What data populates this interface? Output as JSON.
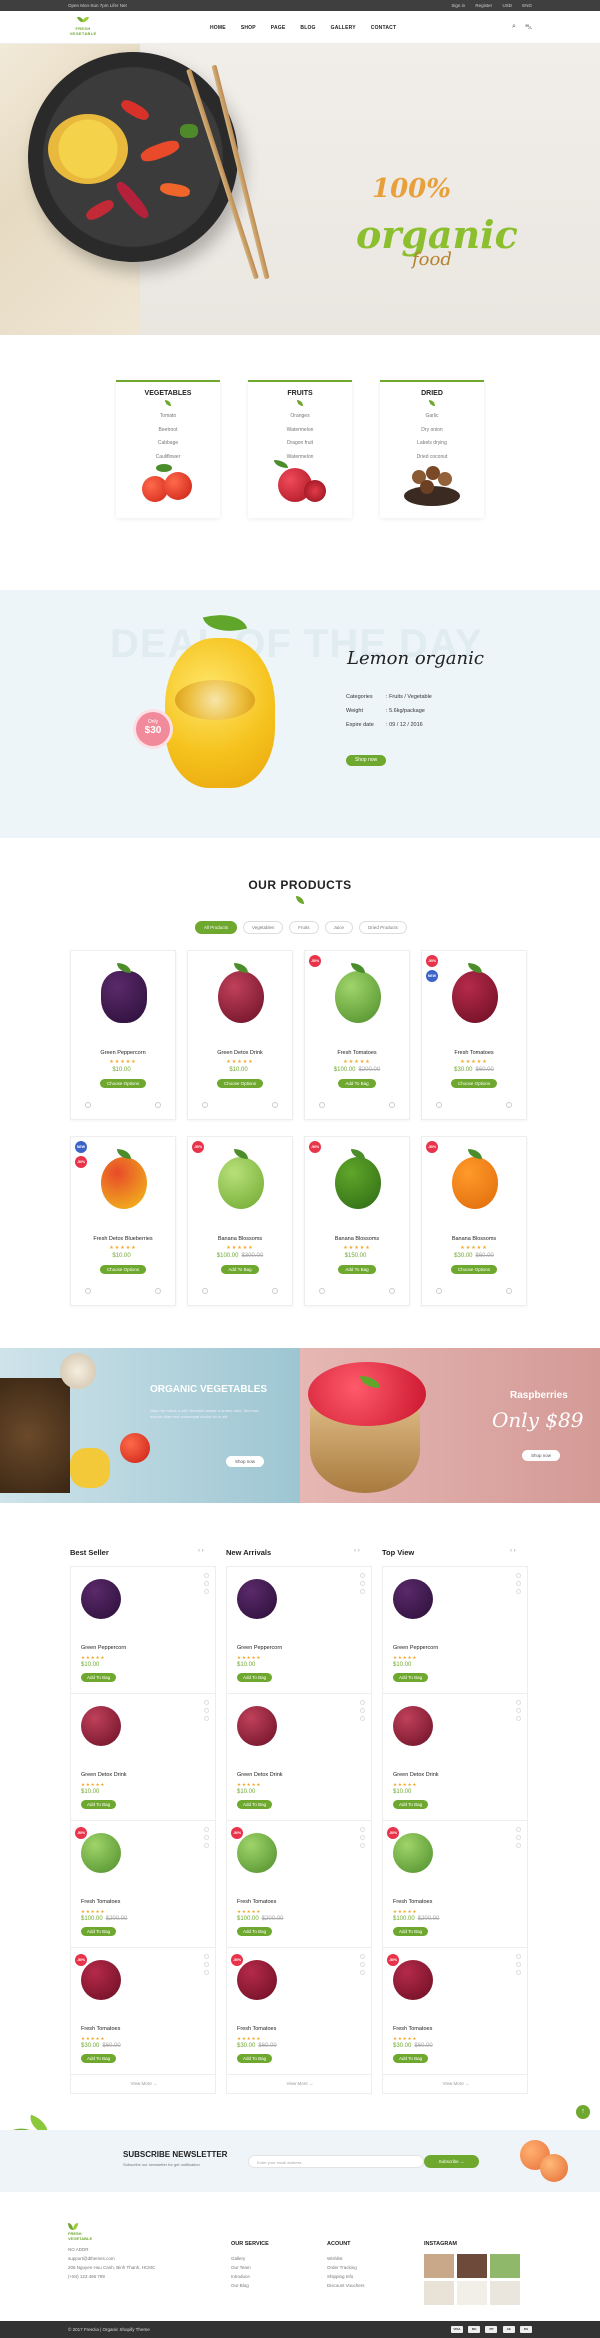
{
  "topbar": {
    "left": "Open Mon-Sun 7pm Lifer Net",
    "links": [
      "Sign in",
      "Register",
      "USD",
      "ENG"
    ]
  },
  "brand": {
    "logo": "FRESH VEGETABLE"
  },
  "nav": [
    "HOME",
    "SHOP",
    "PAGE",
    "BLOG",
    "GALLERY",
    "CONTACT"
  ],
  "hero": {
    "line1": "100%",
    "line2": "organic",
    "line3": "food"
  },
  "categories": [
    {
      "title": "VEGETABLES",
      "items": [
        "Tomato",
        "Beetroot",
        "Cabbage",
        "Cauliflower"
      ]
    },
    {
      "title": "FRUITS",
      "items": [
        "Oranges",
        "Watermelon",
        "Dragon fruit",
        "Watermelon"
      ]
    },
    {
      "title": "DRIED",
      "items": [
        "Garlic",
        "Dry onion",
        "Labels drying",
        "Dried coconut"
      ]
    }
  ],
  "deal": {
    "bg_text": "DEAL OF THE DAY",
    "title": "Lemon organic",
    "badge_small": "Only",
    "badge_price": "$30",
    "cat_k": "Categories",
    "cat_v": "Fruits / Vegetable",
    "wt_k": "Weight",
    "wt_v": "5.6kg/package",
    "ex_k": "Expire date",
    "ex_v": "09 / 12 / 2016",
    "button": "Shop now"
  },
  "products": {
    "title": "OUR PRODUCTS",
    "filters": [
      "All Products",
      "Vegetables",
      "Fruits",
      "Juice",
      "Dried Products"
    ],
    "items": [
      {
        "name": "Green Peppercorn",
        "stars": "★★★★★",
        "price": "$10.00",
        "old": "",
        "btn": "Choose Options"
      },
      {
        "name": "Green Detox Drink",
        "stars": "★★★★★",
        "price": "$10.00",
        "old": "",
        "btn": "Choose Options"
      },
      {
        "name": "Fresh Tomatoes",
        "stars": "★★★★★",
        "price": "$100.00",
        "old": "$200.00",
        "btn": "Add To Bag",
        "tag": "-50%"
      },
      {
        "name": "Fresh Tomatoes",
        "stars": "★★★★★",
        "price": "$30.00",
        "old": "$60.00",
        "btn": "Choose Options",
        "tag": "-50%",
        "tag2": "NEW"
      },
      {
        "name": "Fresh Detox Blueberries",
        "stars": "★★★★★",
        "price": "$10.00",
        "old": "",
        "btn": "Choose Options",
        "tag": "NEW",
        "tag2": "-50%"
      },
      {
        "name": "Banana Blossoms",
        "stars": "★★★★★",
        "price": "$100.00",
        "old": "$300.00",
        "btn": "Add To Bag",
        "tag": "-50%"
      },
      {
        "name": "Banana Blossoms",
        "stars": "★★★★★",
        "price": "$150.00",
        "old": "",
        "btn": "Add To Bag",
        "tag": "-50%"
      },
      {
        "name": "Banana Blossoms",
        "stars": "★★★★★",
        "price": "$30.00",
        "old": "$60.00",
        "btn": "Choose Options",
        "tag": "-50%"
      }
    ]
  },
  "banners": {
    "left_title": "ORGANIC VEGETABLES",
    "left_text": "Nam nec tellus a odio tincidunt auctor a ornare odio. Sed non mauris vitae erat consequat auctor eu in elit.",
    "left_btn": "Shop now",
    "right_title": "Raspberries",
    "right_price": "Only $89",
    "right_btn": "Shop now"
  },
  "lists": {
    "columns": [
      "Best Seller",
      "New Arrivals",
      "Top View"
    ],
    "items": [
      {
        "name": "Green Peppercorn",
        "stars": "★★★★★",
        "price": "$10.00",
        "old": "",
        "btn": "Add To Bag"
      },
      {
        "name": "Green Detox Drink",
        "stars": "★★★★★",
        "price": "$10.00",
        "old": "",
        "btn": "Add To Bag"
      },
      {
        "name": "Fresh Tomatoes",
        "stars": "★★★★★",
        "price": "$100.00",
        "old": "$200.00",
        "btn": "Add To Bag"
      },
      {
        "name": "Fresh Tomatoes",
        "stars": "★★★★★",
        "price": "$30.00",
        "old": "$60.00",
        "btn": "Add To Bag"
      }
    ],
    "view_more": "View More  →"
  },
  "newsletter": {
    "title": "SUBSCRIBE NEWSLETTER",
    "text": "Subscribe our newsletter for get notification",
    "placeholder": "Enter your email address",
    "button": "Subscribe  →"
  },
  "footer": {
    "contact": [
      "NO ADDR",
      "support@dthemes.com",
      "205 Nguyen Huu Canh, Binh Thanh, HCMC",
      "(+84) 123 456 789"
    ],
    "service_title": "OUR SERVICE",
    "service": [
      "Gallery",
      "Our Team",
      "Introduce",
      "Our Blog"
    ],
    "account_title": "ACOUNT",
    "account": [
      "Wishlist",
      "Order Tracking",
      "Shipping Info",
      "Discount Vouchers"
    ],
    "instagram_title": "INSTAGRAM"
  },
  "copyright": "© 2017 Freezia | Organic Shopify Theme",
  "payments": [
    "VISA",
    "MC",
    "PP",
    "AE",
    "DS"
  ]
}
